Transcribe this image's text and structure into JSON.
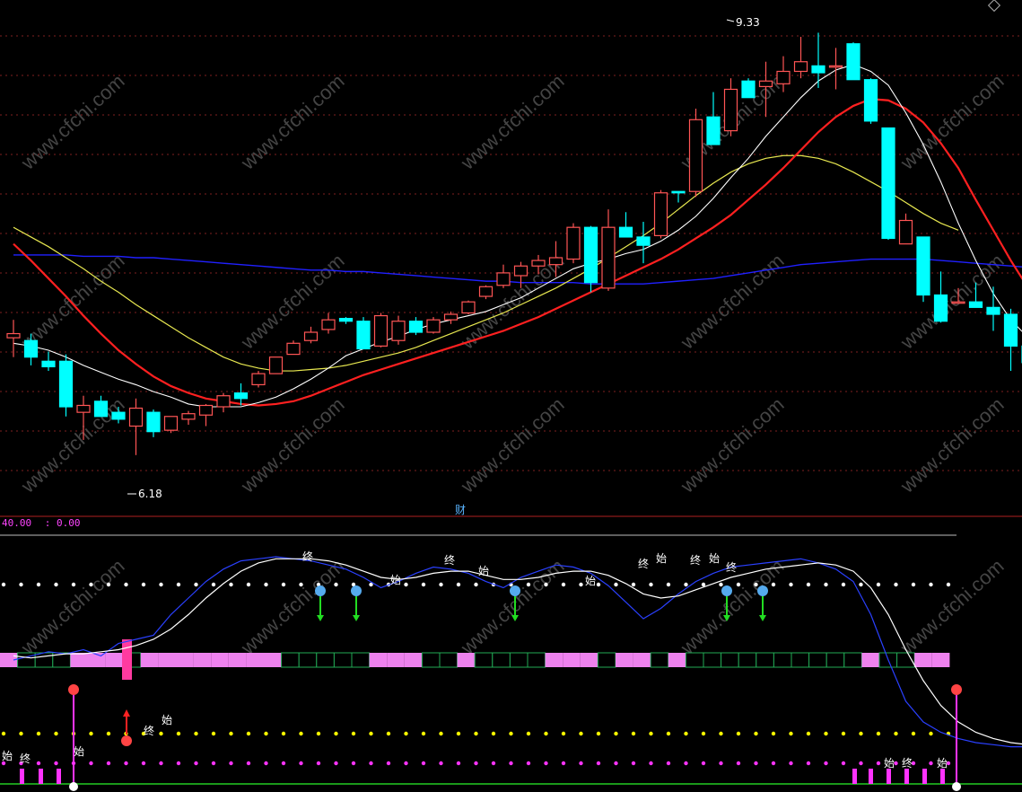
{
  "colors": {
    "background": "#000000",
    "up_candle": "#ff5555",
    "down_candle": "#00ffff",
    "ma_short": "#ffffff",
    "ma_mid": "#ff2020",
    "ma_long": "#e8e850",
    "ma_longest": "#2020ff",
    "grid": "#802020",
    "pink_bar": "#ee82ee",
    "green_arrow": "#22dd22",
    "magenta": "#ff33ff",
    "yellow_dot": "#ffff00"
  },
  "price_labels": {
    "high": "9.33",
    "low": "6.18"
  },
  "top_marker": "财",
  "indicator_header": {
    "left_value": "40.00",
    "right_value": ": 0.00"
  },
  "markers": {
    "start": "始",
    "end": "终"
  },
  "chart_data": {
    "type": "candlestick",
    "title": "",
    "y_range": [
      5.95,
      9.45
    ],
    "candles": [
      {
        "o": 7.12,
        "h": 7.25,
        "l": 6.98,
        "c": 7.15
      },
      {
        "o": 7.1,
        "h": 7.15,
        "l": 6.92,
        "c": 6.98
      },
      {
        "o": 6.95,
        "h": 7.02,
        "l": 6.88,
        "c": 6.91
      },
      {
        "o": 6.95,
        "h": 7.0,
        "l": 6.55,
        "c": 6.62
      },
      {
        "o": 6.58,
        "h": 6.7,
        "l": 6.38,
        "c": 6.63
      },
      {
        "o": 6.66,
        "h": 6.7,
        "l": 6.55,
        "c": 6.55
      },
      {
        "o": 6.58,
        "h": 6.62,
        "l": 6.5,
        "c": 6.53
      },
      {
        "o": 6.48,
        "h": 6.68,
        "l": 6.27,
        "c": 6.61
      },
      {
        "o": 6.58,
        "h": 6.6,
        "l": 6.4,
        "c": 6.44
      },
      {
        "o": 6.45,
        "h": 6.55,
        "l": 6.43,
        "c": 6.55
      },
      {
        "o": 6.53,
        "h": 6.59,
        "l": 6.49,
        "c": 6.57
      },
      {
        "o": 6.56,
        "h": 6.64,
        "l": 6.48,
        "c": 6.63
      },
      {
        "o": 6.62,
        "h": 6.72,
        "l": 6.58,
        "c": 6.7
      },
      {
        "o": 6.72,
        "h": 6.79,
        "l": 6.63,
        "c": 6.68
      },
      {
        "o": 6.78,
        "h": 6.88,
        "l": 6.76,
        "c": 6.86
      },
      {
        "o": 6.86,
        "h": 6.98,
        "l": 6.86,
        "c": 6.98
      },
      {
        "o": 7.0,
        "h": 7.1,
        "l": 7.0,
        "c": 7.08
      },
      {
        "o": 7.1,
        "h": 7.2,
        "l": 7.08,
        "c": 7.16
      },
      {
        "o": 7.18,
        "h": 7.3,
        "l": 7.15,
        "c": 7.25
      },
      {
        "o": 7.26,
        "h": 7.27,
        "l": 7.22,
        "c": 7.24
      },
      {
        "o": 7.24,
        "h": 7.27,
        "l": 7.04,
        "c": 7.04
      },
      {
        "o": 7.06,
        "h": 7.3,
        "l": 7.05,
        "c": 7.28
      },
      {
        "o": 7.1,
        "h": 7.28,
        "l": 7.07,
        "c": 7.24
      },
      {
        "o": 7.24,
        "h": 7.27,
        "l": 7.14,
        "c": 7.16
      },
      {
        "o": 7.16,
        "h": 7.27,
        "l": 7.15,
        "c": 7.25
      },
      {
        "o": 7.25,
        "h": 7.31,
        "l": 7.22,
        "c": 7.29
      },
      {
        "o": 7.3,
        "h": 7.39,
        "l": 7.29,
        "c": 7.38
      },
      {
        "o": 7.42,
        "h": 7.5,
        "l": 7.4,
        "c": 7.49
      },
      {
        "o": 7.5,
        "h": 7.65,
        "l": 7.48,
        "c": 7.59
      },
      {
        "o": 7.57,
        "h": 7.67,
        "l": 7.48,
        "c": 7.64
      },
      {
        "o": 7.64,
        "h": 7.72,
        "l": 7.58,
        "c": 7.68
      },
      {
        "o": 7.65,
        "h": 7.82,
        "l": 7.56,
        "c": 7.7
      },
      {
        "o": 7.69,
        "h": 7.95,
        "l": 7.66,
        "c": 7.92
      },
      {
        "o": 7.92,
        "h": 7.93,
        "l": 7.45,
        "c": 7.52
      },
      {
        "o": 7.48,
        "h": 8.05,
        "l": 7.46,
        "c": 7.92
      },
      {
        "o": 7.92,
        "h": 8.03,
        "l": 7.85,
        "c": 7.85
      },
      {
        "o": 7.85,
        "h": 7.96,
        "l": 7.66,
        "c": 7.79
      },
      {
        "o": 7.86,
        "h": 8.19,
        "l": 7.84,
        "c": 8.17
      },
      {
        "o": 8.18,
        "h": 8.18,
        "l": 8.1,
        "c": 8.17
      },
      {
        "o": 8.18,
        "h": 8.78,
        "l": 8.14,
        "c": 8.7
      },
      {
        "o": 8.72,
        "h": 8.9,
        "l": 8.52,
        "c": 8.52
      },
      {
        "o": 8.62,
        "h": 9.0,
        "l": 8.58,
        "c": 8.92
      },
      {
        "o": 8.98,
        "h": 9.0,
        "l": 8.86,
        "c": 8.86
      },
      {
        "o": 8.94,
        "h": 9.12,
        "l": 8.72,
        "c": 8.98
      },
      {
        "o": 8.96,
        "h": 9.16,
        "l": 8.9,
        "c": 9.05
      },
      {
        "o": 9.05,
        "h": 9.3,
        "l": 9.0,
        "c": 9.12
      },
      {
        "o": 9.09,
        "h": 9.33,
        "l": 8.93,
        "c": 9.04
      },
      {
        "o": 9.09,
        "h": 9.22,
        "l": 8.92,
        "c": 9.09
      },
      {
        "o": 9.25,
        "h": 9.26,
        "l": 8.99,
        "c": 8.99
      },
      {
        "o": 8.99,
        "h": 9.0,
        "l": 8.67,
        "c": 8.69
      },
      {
        "o": 8.64,
        "h": 8.64,
        "l": 7.83,
        "c": 7.84
      },
      {
        "o": 7.8,
        "h": 8.02,
        "l": 7.8,
        "c": 7.97
      },
      {
        "o": 7.85,
        "h": 7.85,
        "l": 7.38,
        "c": 7.43
      },
      {
        "o": 7.43,
        "h": 7.6,
        "l": 7.23,
        "c": 7.24
      },
      {
        "o": 7.38,
        "h": 7.48,
        "l": 7.38,
        "c": 7.38
      },
      {
        "o": 7.38,
        "h": 7.52,
        "l": 7.38,
        "c": 7.34
      },
      {
        "o": 7.34,
        "h": 7.49,
        "l": 7.17,
        "c": 7.29
      },
      {
        "o": 7.29,
        "h": 7.33,
        "l": 6.88,
        "c": 7.06
      },
      {
        "o": 7.06,
        "h": 7.07,
        "l": 6.91,
        "c": 6.94
      },
      {
        "o": 6.95,
        "h": 7.06,
        "l": 6.9,
        "c": 6.96
      },
      {
        "o": 6.7,
        "h": 6.87,
        "l": 6.57,
        "c": 6.8
      }
    ],
    "ma_short": [
      7.08,
      7.06,
      7.03,
      6.98,
      6.92,
      6.87,
      6.82,
      6.78,
      6.73,
      6.69,
      6.64,
      6.62,
      6.62,
      6.62,
      6.65,
      6.69,
      6.75,
      6.82,
      6.9,
      6.99,
      7.04,
      7.09,
      7.13,
      7.18,
      7.22,
      7.25,
      7.28,
      7.31,
      7.36,
      7.41,
      7.48,
      7.55,
      7.62,
      7.66,
      7.69,
      7.73,
      7.76,
      7.82,
      7.9,
      8.0,
      8.13,
      8.28,
      8.42,
      8.58,
      8.72,
      8.86,
      8.98,
      9.06,
      9.1,
      9.05,
      8.95,
      8.75,
      8.52,
      8.25,
      7.95,
      7.68,
      7.44,
      7.25,
      7.12,
      7.03,
      6.93
    ],
    "ma_mid": [
      7.8,
      7.68,
      7.55,
      7.42,
      7.28,
      7.15,
      7.03,
      6.93,
      6.84,
      6.77,
      6.72,
      6.68,
      6.66,
      6.64,
      6.63,
      6.64,
      6.66,
      6.7,
      6.75,
      6.8,
      6.85,
      6.89,
      6.93,
      6.97,
      7.01,
      7.05,
      7.09,
      7.13,
      7.17,
      7.22,
      7.27,
      7.33,
      7.39,
      7.45,
      7.51,
      7.57,
      7.63,
      7.69,
      7.76,
      7.84,
      7.92,
      8.01,
      8.12,
      8.23,
      8.35,
      8.48,
      8.61,
      8.72,
      8.8,
      8.85,
      8.84,
      8.78,
      8.68,
      8.53,
      8.35,
      8.12,
      7.9,
      7.68,
      7.48,
      7.3,
      7.14
    ],
    "ma_long": [
      7.92,
      7.85,
      7.78,
      7.7,
      7.62,
      7.53,
      7.45,
      7.36,
      7.28,
      7.2,
      7.12,
      7.05,
      6.98,
      6.93,
      6.9,
      6.88,
      6.88,
      6.89,
      6.9,
      6.92,
      6.95,
      6.98,
      7.01,
      7.05,
      7.1,
      7.15,
      7.2,
      7.25,
      7.3,
      7.36,
      7.42,
      7.48,
      7.55,
      7.62,
      7.7,
      7.78,
      7.86,
      7.95,
      8.05,
      8.15,
      8.24,
      8.32,
      8.38,
      8.42,
      8.44,
      8.44,
      8.42,
      8.38,
      8.32,
      8.25,
      8.18,
      8.1,
      8.02,
      7.95,
      7.9
    ],
    "ma_longest": [
      7.72,
      7.72,
      7.72,
      7.72,
      7.71,
      7.71,
      7.71,
      7.7,
      7.7,
      7.69,
      7.68,
      7.67,
      7.66,
      7.65,
      7.64,
      7.63,
      7.62,
      7.61,
      7.61,
      7.6,
      7.6,
      7.59,
      7.58,
      7.57,
      7.56,
      7.55,
      7.54,
      7.53,
      7.53,
      7.52,
      7.52,
      7.52,
      7.52,
      7.51,
      7.51,
      7.51,
      7.51,
      7.52,
      7.53,
      7.54,
      7.55,
      7.57,
      7.59,
      7.61,
      7.63,
      7.65,
      7.66,
      7.67,
      7.68,
      7.69,
      7.69,
      7.69,
      7.69,
      7.68,
      7.67,
      7.66,
      7.65,
      7.64,
      7.63,
      7.62,
      7.6
    ]
  },
  "indicator_data": {
    "type": "line",
    "y_range": [
      0,
      100
    ],
    "blue": [
      50,
      52,
      54,
      53,
      55,
      52,
      58,
      60,
      62,
      72,
      80,
      88,
      94,
      98,
      99,
      100,
      99,
      98,
      96,
      94,
      90,
      85,
      88,
      92,
      95,
      94,
      92,
      88,
      85,
      90,
      93,
      96,
      95,
      92,
      86,
      78,
      70,
      75,
      82,
      88,
      92,
      95,
      96,
      97,
      98,
      99,
      97,
      94,
      88,
      72,
      50,
      30,
      20,
      15,
      12,
      10,
      9,
      8,
      8,
      8,
      9
    ],
    "white": [
      52,
      51,
      52,
      53,
      53,
      54,
      55,
      57,
      60,
      65,
      72,
      80,
      87,
      93,
      97,
      99,
      99,
      99,
      98,
      96,
      93,
      90,
      89,
      90,
      92,
      93,
      93,
      91,
      89,
      89,
      90,
      92,
      93,
      93,
      91,
      87,
      82,
      80,
      81,
      84,
      87,
      90,
      92,
      94,
      95,
      96,
      97,
      96,
      93,
      85,
      72,
      55,
      40,
      28,
      20,
      15,
      12,
      10,
      9,
      9,
      9
    ]
  },
  "pink_band": [
    1,
    0,
    0,
    0,
    1,
    1,
    1,
    0,
    1,
    1,
    1,
    1,
    1,
    1,
    1,
    1,
    0,
    0,
    0,
    0,
    0,
    1,
    1,
    1,
    0,
    0,
    1,
    0,
    0,
    0,
    0,
    1,
    1,
    1,
    0,
    1,
    1,
    0,
    1,
    0,
    0,
    0,
    0,
    0,
    0,
    0,
    0,
    0,
    0,
    1,
    0,
    0,
    1,
    1
  ]
}
